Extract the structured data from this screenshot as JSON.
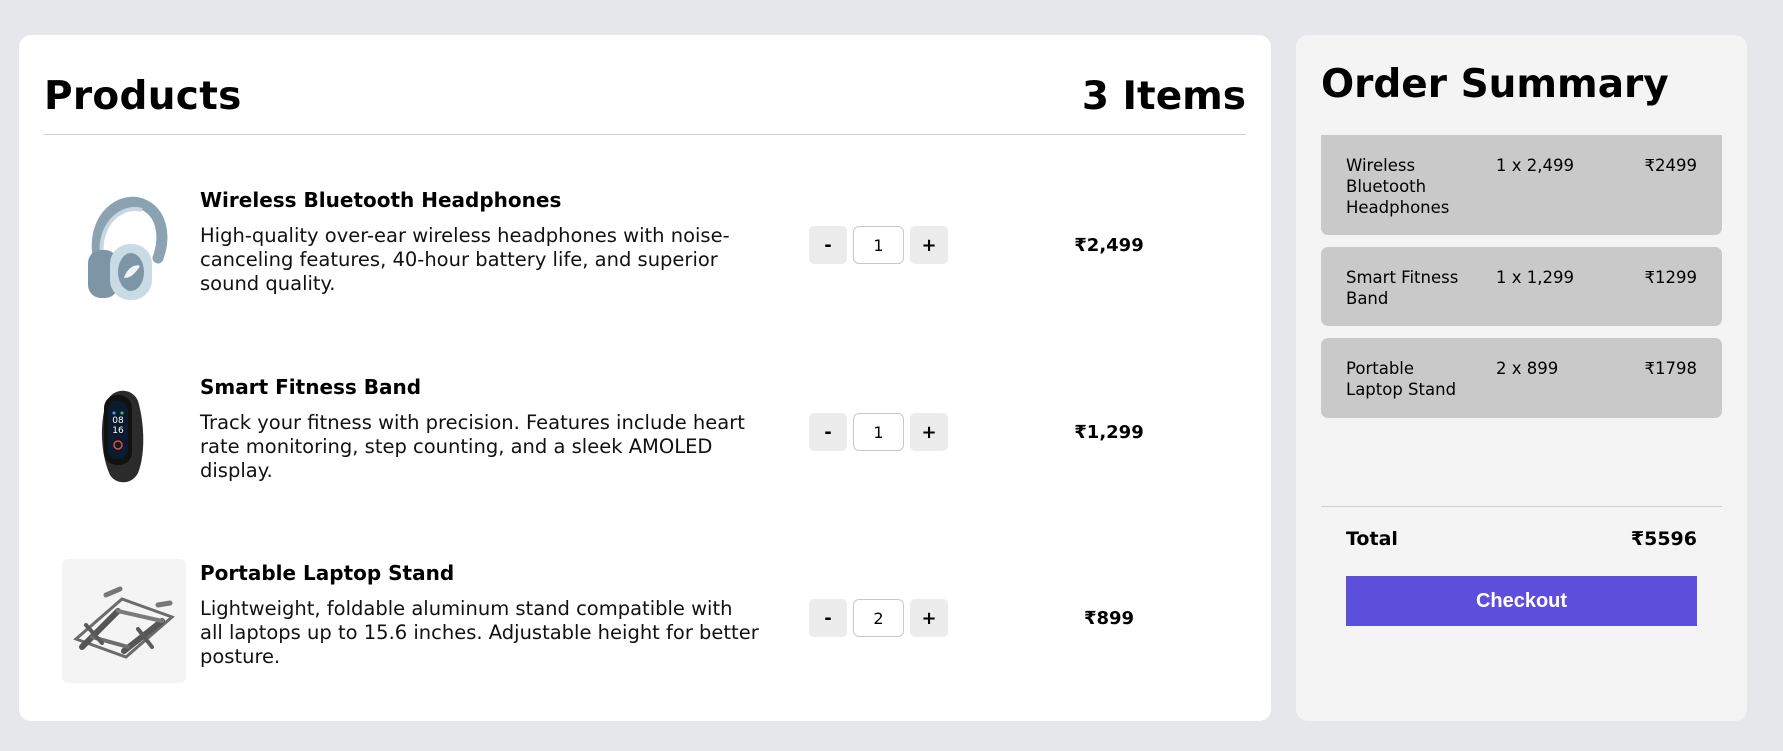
{
  "products": {
    "title": "Products",
    "count_label": "3 Items",
    "items": [
      {
        "name": "Wireless Bluetooth Headphones",
        "description": "High-quality over-ear wireless headphones with noise-canceling features, 40-hour battery life, and superior sound quality.",
        "quantity": "1",
        "price": "₹2,499",
        "decrement_label": "-",
        "increment_label": "+",
        "image_icon": "headphones-image"
      },
      {
        "name": "Smart Fitness Band",
        "description": "Track your fitness with precision. Features include heart rate monitoring, step counting, and a sleek AMOLED display.",
        "quantity": "1",
        "price": "₹1,299",
        "decrement_label": "-",
        "increment_label": "+",
        "image_icon": "fitness-band-image"
      },
      {
        "name": "Portable Laptop Stand",
        "description": "Lightweight, foldable aluminum stand compatible with all laptops up to 15.6 inches. Adjustable height for better posture.",
        "quantity": "2",
        "price": "₹899",
        "decrement_label": "-",
        "increment_label": "+",
        "image_icon": "laptop-stand-image"
      }
    ]
  },
  "summary": {
    "title": "Order Summary",
    "lines": [
      {
        "name": "Wireless Bluetooth Headphones",
        "qty_text": "1 x 2,499",
        "amount": "₹2499"
      },
      {
        "name": "Smart Fitness Band",
        "qty_text": "1 x 1,299",
        "amount": "₹1299"
      },
      {
        "name": "Portable Laptop Stand",
        "qty_text": "2 x 899",
        "amount": "₹1798"
      }
    ],
    "total_label": "Total",
    "total_value": "₹5596",
    "checkout_label": "Checkout"
  },
  "colors": {
    "page_background": "#e5e7eb",
    "checkout_button": "#5b4fdc",
    "summary_card": "#c9c9c9"
  }
}
